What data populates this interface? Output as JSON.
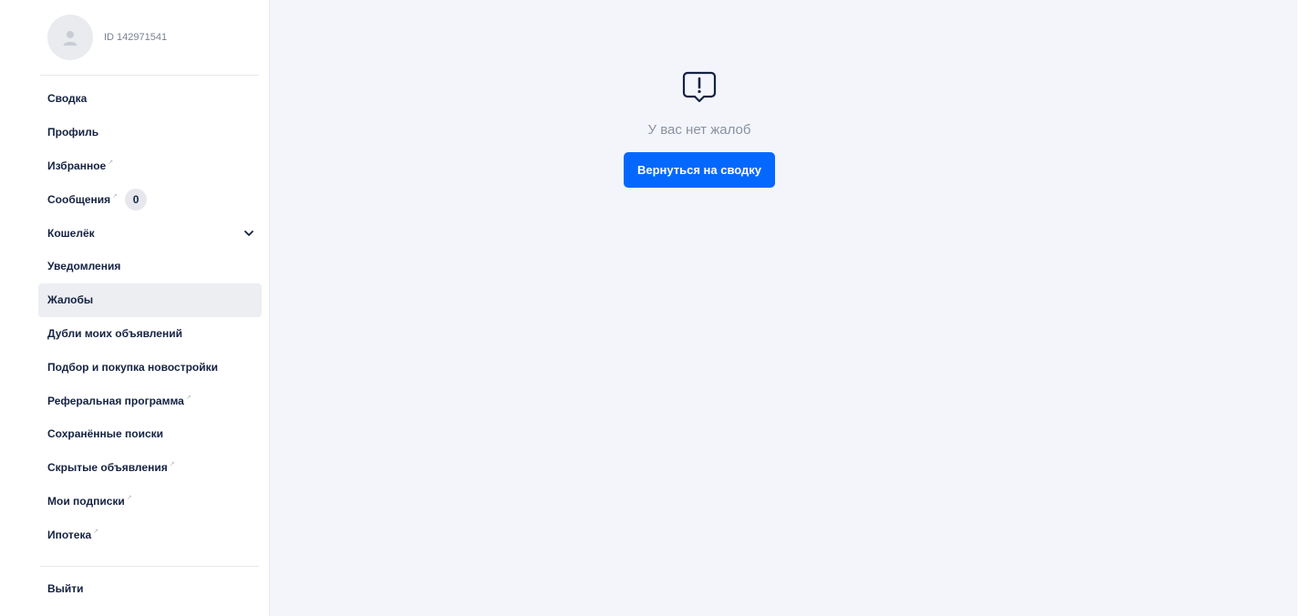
{
  "profile": {
    "user_id": "ID 142971541",
    "avatar_icon": "user-placeholder-icon"
  },
  "sidebar": {
    "items": [
      {
        "label": "Сводка",
        "external": false
      },
      {
        "label": "Профиль",
        "external": false
      },
      {
        "label": "Избранное",
        "external": true
      },
      {
        "label": "Сообщения",
        "external": true,
        "badge": "0"
      },
      {
        "label": "Кошелёк",
        "external": false,
        "expandable": true
      },
      {
        "label": "Уведомления",
        "external": false
      },
      {
        "label": "Жалобы",
        "external": false,
        "active": true
      },
      {
        "label": "Дубли моих объявлений",
        "external": false
      },
      {
        "label": "Подбор и покупка новостройки",
        "external": false
      },
      {
        "label": "Реферальная программа",
        "external": true
      },
      {
        "label": "Сохранённые поиски",
        "external": false
      },
      {
        "label": "Скрытые объявления",
        "external": true
      },
      {
        "label": "Мои подписки",
        "external": true
      },
      {
        "label": "Ипотека",
        "external": true
      }
    ],
    "logout_label": "Выйти"
  },
  "main": {
    "empty_icon": "alert-message-icon",
    "empty_text": "У вас нет жалоб",
    "back_button_label": "Вернуться на сводку"
  },
  "colors": {
    "accent": "#0468ff",
    "background": "#f3f5fb",
    "active_item": "#eceef2",
    "text": "#152242"
  }
}
